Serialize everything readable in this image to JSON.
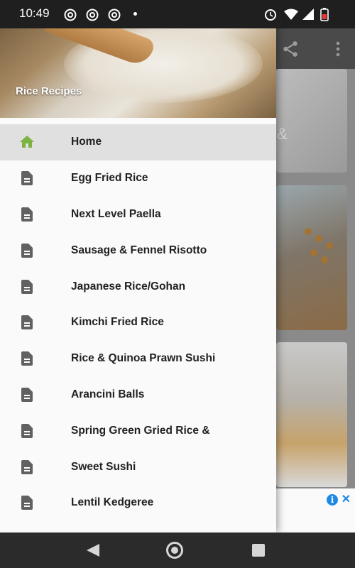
{
  "status_bar": {
    "time": "10:49",
    "notification_icons": [
      "chrome-icon",
      "chrome-icon",
      "chrome-icon"
    ],
    "right_icons": [
      "alarm-icon",
      "wifi-icon",
      "signal-icon",
      "battery-icon"
    ]
  },
  "drawer": {
    "header_title": "Rice Recipes",
    "items": [
      {
        "label": "Home",
        "icon": "home-icon",
        "active": true
      },
      {
        "label": "Egg Fried Rice",
        "icon": "document-icon"
      },
      {
        "label": "Next Level Paella",
        "icon": "document-icon"
      },
      {
        "label": "Sausage & Fennel Risotto",
        "icon": "document-icon"
      },
      {
        "label": "Japanese Rice/Gohan",
        "icon": "document-icon"
      },
      {
        "label": "Kimchi Fried Rice",
        "icon": "document-icon"
      },
      {
        "label": "Rice & Quinoa Prawn Sushi",
        "icon": "document-icon"
      },
      {
        "label": "Arancini Balls",
        "icon": "document-icon"
      },
      {
        "label": "Spring Green Gried Rice &",
        "icon": "document-icon"
      },
      {
        "label": "Sweet Sushi",
        "icon": "document-icon"
      },
      {
        "label": "Lentil Kedgeree",
        "icon": "document-icon"
      }
    ]
  },
  "background": {
    "card_text_fragment": "&",
    "toolbar_icons": [
      "share-icon",
      "more-vert-icon"
    ],
    "ad_icons": [
      "info-icon",
      "close-icon"
    ]
  },
  "navigation": {
    "buttons": [
      "back-button",
      "home-button",
      "recents-button"
    ]
  },
  "colors": {
    "home_icon": "#7CB342",
    "document_icon": "#616161",
    "active_item_bg": "#E0E0E0",
    "drawer_bg": "#FAFAFA"
  }
}
